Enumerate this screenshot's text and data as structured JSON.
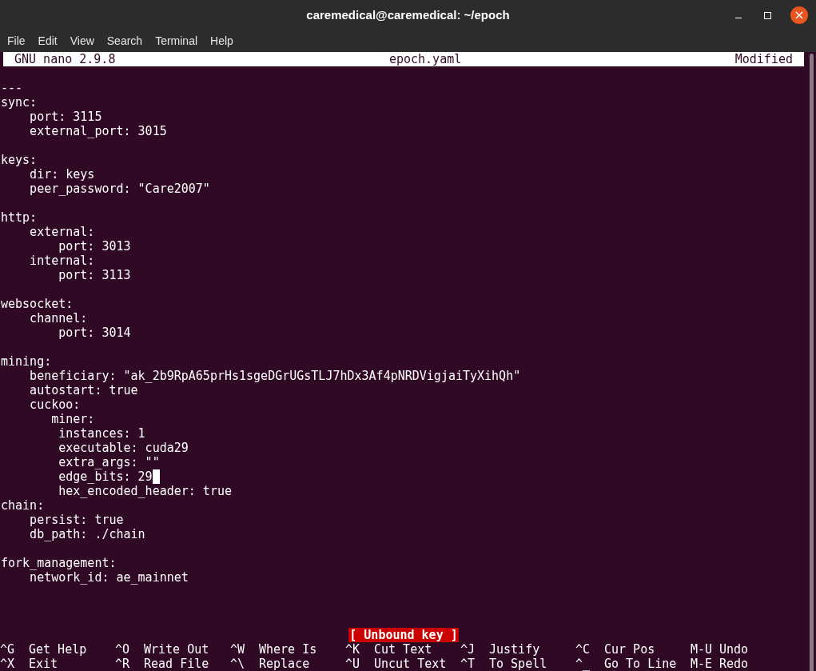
{
  "window": {
    "title": "caremedical@caremedical: ~/epoch"
  },
  "menu": [
    "File",
    "Edit",
    "View",
    "Search",
    "Terminal",
    "Help"
  ],
  "nano_header": {
    "version": "GNU nano 2.9.8",
    "filename": "epoch.yaml",
    "status": "Modified"
  },
  "blocks": [
    {
      "lines": [
        {
          "text": "---",
          "cursor": false
        },
        {
          "text": "sync:",
          "cursor": false
        },
        {
          "text": "    port: 3115",
          "cursor": false
        },
        {
          "text": "    external_port: 3015",
          "cursor": false
        }
      ]
    },
    {
      "lines": [
        {
          "text": "keys:",
          "cursor": false
        },
        {
          "text": "    dir: keys",
          "cursor": false
        },
        {
          "text": "    peer_password: \"Care2007\"",
          "cursor": false
        }
      ]
    },
    {
      "lines": [
        {
          "text": "http:",
          "cursor": false
        },
        {
          "text": "    external:",
          "cursor": false
        },
        {
          "text": "        port: 3013",
          "cursor": false
        },
        {
          "text": "    internal:",
          "cursor": false
        },
        {
          "text": "        port: 3113",
          "cursor": false
        }
      ]
    },
    {
      "lines": [
        {
          "text": "websocket:",
          "cursor": false
        },
        {
          "text": "    channel:",
          "cursor": false
        },
        {
          "text": "        port: 3014",
          "cursor": false
        }
      ]
    },
    {
      "lines": [
        {
          "text": "mining:",
          "cursor": false
        },
        {
          "text": "    beneficiary: \"ak_2b9RpA65prHs1sgeDGrUGsTLJ7hDx3Af4pNRDVigjaiTyXihQh\"",
          "cursor": false
        },
        {
          "text": "    autostart: true",
          "cursor": false
        },
        {
          "text": "    cuckoo:",
          "cursor": false
        },
        {
          "text": "       miner:",
          "cursor": false
        },
        {
          "text": "        instances: 1",
          "cursor": false
        },
        {
          "text": "        executable: cuda29",
          "cursor": false
        },
        {
          "text": "        extra_args: \"\"",
          "cursor": false
        },
        {
          "text": "        edge_bits: 29",
          "cursor": true
        },
        {
          "text": "        hex_encoded_header: true",
          "cursor": false
        },
        {
          "text": "chain:",
          "cursor": false
        },
        {
          "text": "    persist: true",
          "cursor": false
        },
        {
          "text": "    db_path: ./chain",
          "cursor": false
        }
      ]
    },
    {
      "lines": [
        {
          "text": "fork_management:",
          "cursor": false
        },
        {
          "text": "    network_id: ae_mainnet",
          "cursor": false
        }
      ]
    }
  ],
  "status_message": "[ Unbound key ]",
  "shortcuts": [
    {
      "key": "^G",
      "label": "Get Help"
    },
    {
      "key": "^O",
      "label": "Write Out"
    },
    {
      "key": "^W",
      "label": "Where Is"
    },
    {
      "key": "^K",
      "label": "Cut Text"
    },
    {
      "key": "^J",
      "label": "Justify"
    },
    {
      "key": "^C",
      "label": "Cur Pos"
    },
    {
      "key": "M-U",
      "label": "Undo"
    },
    {
      "key": "^X",
      "label": "Exit"
    },
    {
      "key": "^R",
      "label": "Read File"
    },
    {
      "key": "^\\",
      "label": "Replace"
    },
    {
      "key": "^U",
      "label": "Uncut Text"
    },
    {
      "key": "^T",
      "label": "To Spell"
    },
    {
      "key": "^_",
      "label": "Go To Line"
    },
    {
      "key": "M-E",
      "label": "Redo"
    }
  ]
}
